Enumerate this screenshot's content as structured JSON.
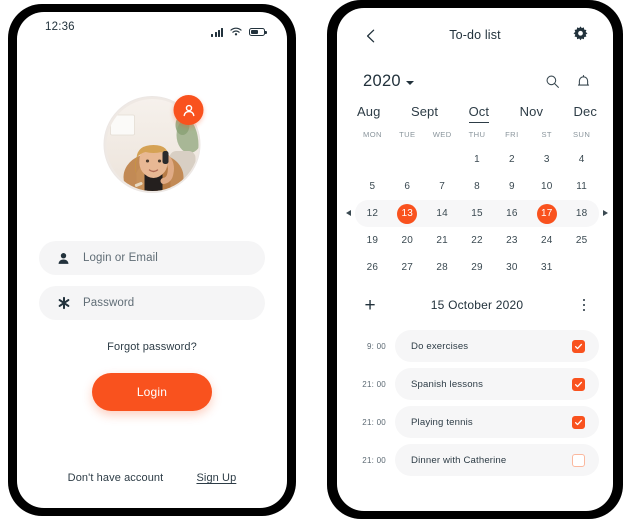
{
  "theme": {
    "accent": "#f9521e",
    "ink": "#22323c",
    "muted": "#8a959c",
    "field_bg": "#f5f5f6",
    "frame": "#000000",
    "screen_bg": "#ffffff"
  },
  "login_screen": {
    "status_bar": {
      "time": "12:36",
      "icons": [
        "signal-icon",
        "wifi-icon",
        "battery-icon"
      ]
    },
    "avatar": {
      "badge_icon": "person-icon",
      "alt": "profile photo"
    },
    "fields": [
      {
        "icon": "person-icon",
        "placeholder": "Login or Email",
        "value": ""
      },
      {
        "icon": "asterisk-icon",
        "placeholder": "Password",
        "value": ""
      }
    ],
    "forgot_label": "Forgot password?",
    "login_button": "Login",
    "footer": {
      "prompt": "Don't have account",
      "signup_label": "Sign Up"
    }
  },
  "todo_screen": {
    "header": {
      "back_icon": "chevron-left-icon",
      "title": "To-do list",
      "settings_icon": "gear-icon"
    },
    "calendar": {
      "year": "2020",
      "year_caret_icon": "chevron-down-icon",
      "search_icon": "search-icon",
      "bell_icon": "bell-icon",
      "months": [
        "Aug",
        "Sept",
        "Oct",
        "Nov",
        "Dec"
      ],
      "active_month": "Oct",
      "day_labels": [
        "MON",
        "TUE",
        "WED",
        "THU",
        "FRI",
        "ST",
        "SUN"
      ],
      "weeks": [
        [
          "",
          "",
          "",
          "1",
          "2",
          "3",
          "4"
        ],
        [
          "5",
          "6",
          "7",
          "8",
          "9",
          "10",
          "11"
        ],
        [
          "12",
          "13",
          "14",
          "15",
          "16",
          "17",
          "18"
        ],
        [
          "19",
          "20",
          "21",
          "22",
          "23",
          "24",
          "25"
        ],
        [
          "26",
          "27",
          "28",
          "29",
          "30",
          "31",
          ""
        ]
      ],
      "highlighted_week_index": 2,
      "selected_days": [
        "13",
        "17"
      ],
      "prev_arrow_icon": "triangle-left-icon",
      "next_arrow_icon": "triangle-right-icon"
    },
    "list_header": {
      "add_icon": "plus-icon",
      "date": "15 October 2020",
      "menu_icon": "kebab-menu-icon"
    },
    "tasks": [
      {
        "time": "9: 00",
        "label": "Do exercises",
        "done": true
      },
      {
        "time": "21: 00",
        "label": "Spanish lessons",
        "done": true
      },
      {
        "time": "21: 00",
        "label": "Playing tennis",
        "done": true
      },
      {
        "time": "21: 00",
        "label": "Dinner with Catherine",
        "done": false
      }
    ]
  }
}
